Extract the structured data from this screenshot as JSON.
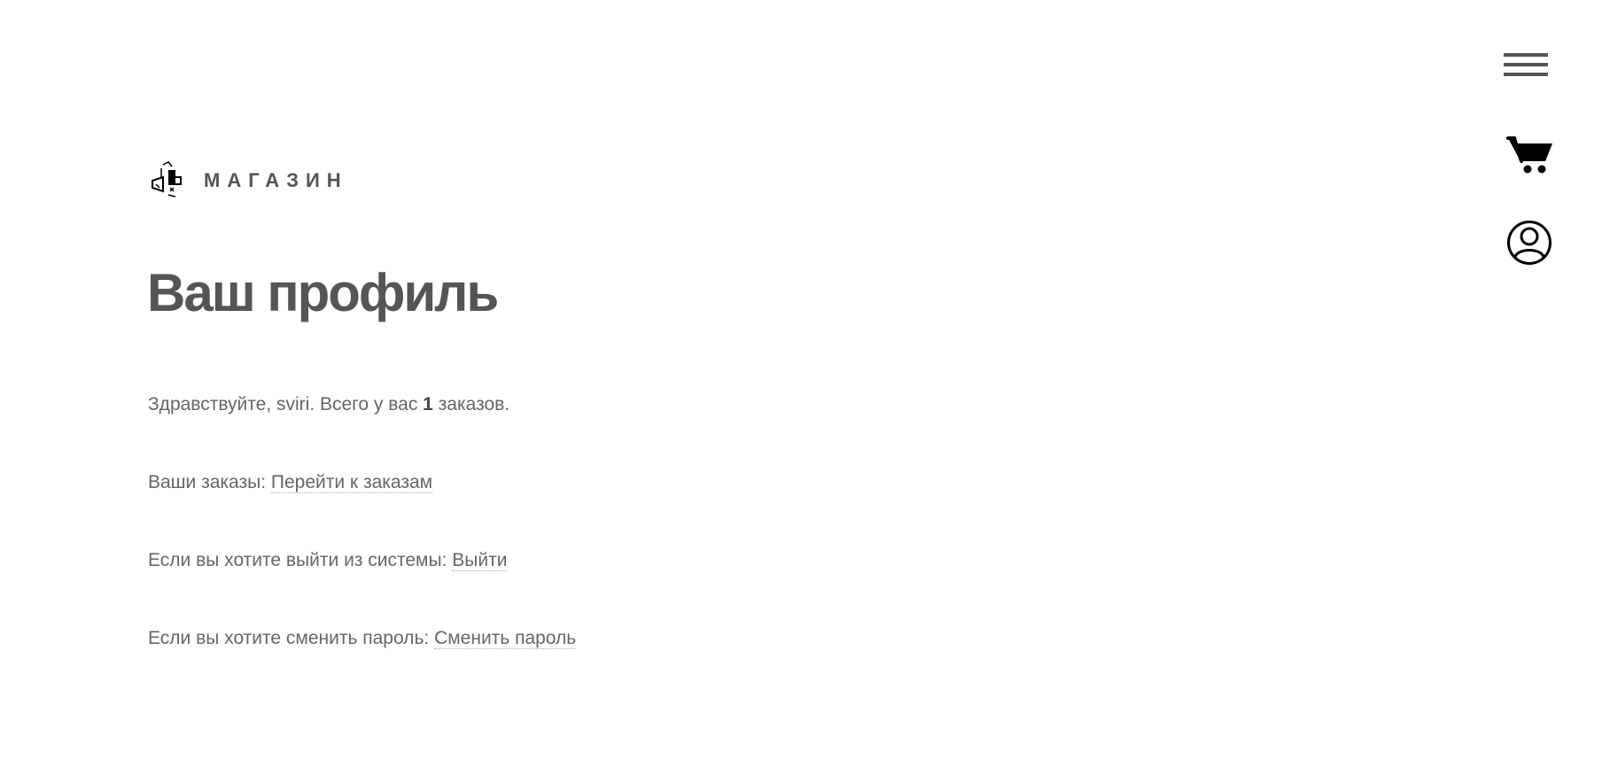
{
  "header": {
    "logo_text": "МАГАЗИН",
    "logo_icon": "shop-logo-icon",
    "menu_icon": "hamburger-menu-icon",
    "cart_icon": "shopping-cart-icon",
    "account_icon": "user-account-icon"
  },
  "main": {
    "title": "Ваш профиль",
    "greeting": {
      "prefix": "Здравствуйте, sviri. Всего у вас ",
      "order_count": "1",
      "suffix": " заказов."
    },
    "orders": {
      "label": "Ваши заказы: ",
      "link": "Перейти к заказам"
    },
    "logout": {
      "label": "Если вы хотите выйти из системы: ",
      "link": "Выйти"
    },
    "change_password": {
      "label": "Если вы хотите сменить пароль: ",
      "link": "Сменить пароль"
    }
  },
  "colors": {
    "text": "#555555",
    "body_text": "#666666",
    "icon": "#000000",
    "background": "#ffffff"
  }
}
